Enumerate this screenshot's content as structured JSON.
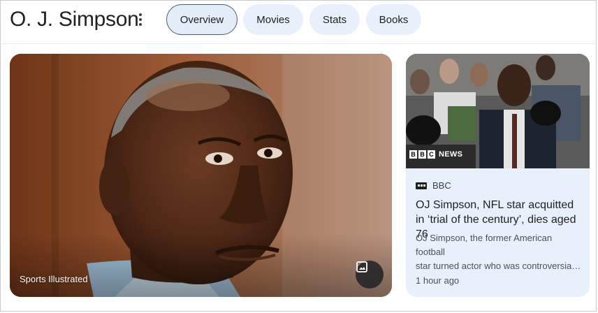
{
  "header": {
    "title": "O. J. Simpson",
    "tabs": [
      {
        "label": "Overview",
        "active": true
      },
      {
        "label": "Movies",
        "active": false
      },
      {
        "label": "Stats",
        "active": false
      },
      {
        "label": "Books",
        "active": false
      }
    ]
  },
  "main_image": {
    "source": "Sports Illustrated",
    "action_icon": "image-icon"
  },
  "news_card": {
    "thumb_logo_box": [
      "B",
      "B",
      "C"
    ],
    "thumb_logo_text": "NEWS",
    "publisher": "BBC",
    "headline": "OJ Simpson, NFL star acquitted in ‘trial of the century’, dies aged 76",
    "snippet_line1": "OJ Simpson, the former American football",
    "snippet_line2": "star turned actor who was controversially ...",
    "time": "1 hour ago"
  },
  "colors": {
    "chip_bg": "#e8f0fb",
    "active_chip_border": "#4d5a67",
    "card_bg": "#e8f0fb"
  }
}
